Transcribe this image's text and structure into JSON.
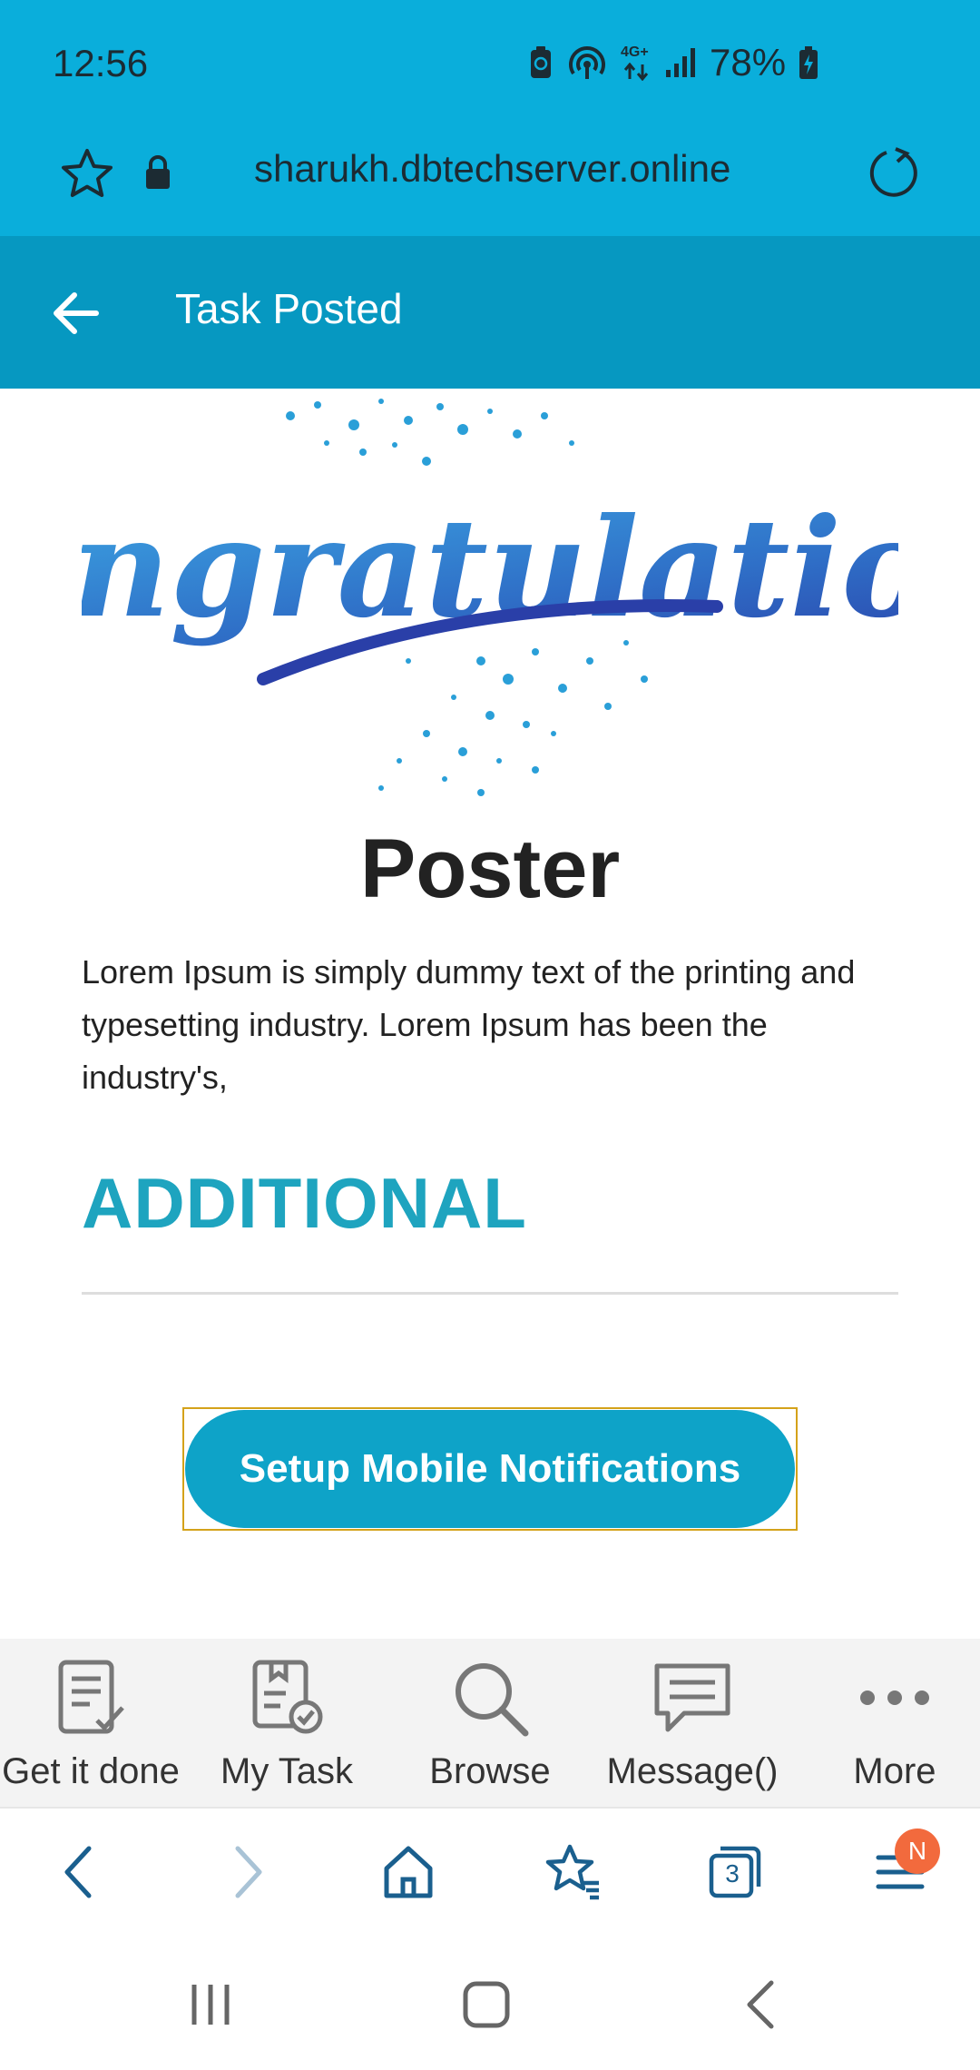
{
  "status_bar": {
    "time": "12:56",
    "network": "4G+",
    "battery": "78%"
  },
  "browser": {
    "url": "sharukh.dbtechserver.online"
  },
  "app_header": {
    "title": "Task Posted"
  },
  "content": {
    "congrats_text": "Congratulations",
    "poster_title": "Poster",
    "description": "Lorem Ipsum is simply dummy text of the printing and typesetting industry. Lorem Ipsum has been the industry's,",
    "additional_heading": "ADDITIONAL",
    "setup_button": "Setup Mobile Notifications"
  },
  "app_nav": {
    "items": [
      {
        "label": "Get it done",
        "icon": "clipboard-check-icon"
      },
      {
        "label": "My Task",
        "icon": "task-box-icon"
      },
      {
        "label": "Browse",
        "icon": "search-icon"
      },
      {
        "label": "Message()",
        "icon": "message-icon"
      },
      {
        "label": "More",
        "icon": "more-dots-icon"
      }
    ]
  },
  "browser_toolbar": {
    "tabs_count": "3",
    "menu_badge": "N"
  },
  "colors": {
    "status_bar": "#0aaedb",
    "app_bar": "#0698c1",
    "accent_text": "#1ea4bf",
    "button": "#0ea3c8"
  }
}
